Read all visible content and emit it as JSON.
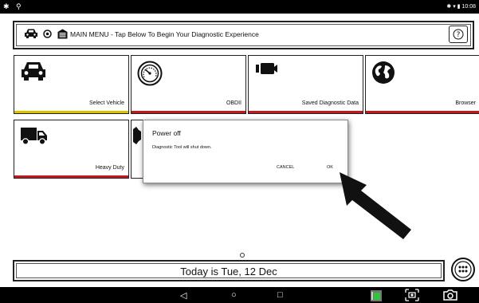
{
  "statusbar": {
    "left_icons": "✱ ⚲",
    "right": "✱ ▾ ▮ 10:08"
  },
  "header": {
    "title": "MAIN MENU - Tap Below To Begin Your Diagnostic Experience",
    "help_label": "?"
  },
  "tiles": [
    {
      "label": "Select Vehicle",
      "accent": "#d9c400",
      "icon": "car-icon"
    },
    {
      "label": "OBDII",
      "accent": "#c0181c",
      "icon": "gauge-icon"
    },
    {
      "label": "Saved Diagnostic Data",
      "accent": "#c0181c",
      "icon": "video-camera-icon"
    },
    {
      "label": "Browser",
      "accent": "#c0181c",
      "icon": "globe-icon"
    },
    {
      "label": "Heavy Duty",
      "accent": "#c0181c",
      "icon": "truck-icon"
    }
  ],
  "dialog": {
    "title": "Power off",
    "message": "Diagnostic Tool will shut down.",
    "cancel": "CANCEL",
    "ok": "OK"
  },
  "datebar": {
    "text": "Today is Tue, 12 Dec"
  },
  "navbar": {
    "back": "◁",
    "home": "○",
    "recents": "□"
  }
}
